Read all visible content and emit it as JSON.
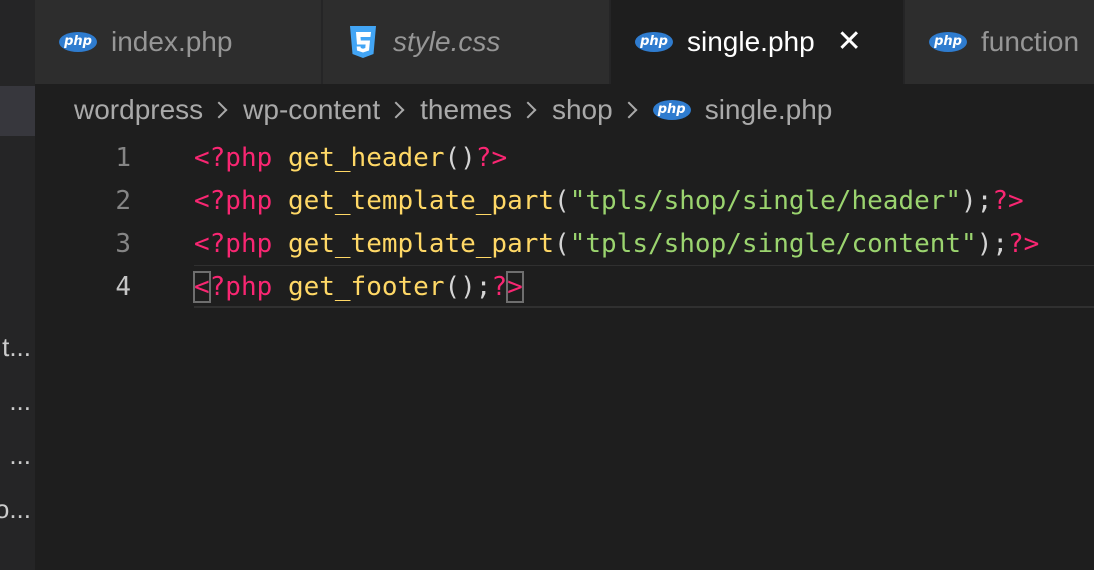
{
  "sidebar": {
    "truncated_items": [
      "t...",
      "...",
      "...",
      "o..."
    ]
  },
  "tabs": [
    {
      "label": "index.php",
      "icon": "php-icon",
      "icon_text": "php",
      "italic": false,
      "active": false
    },
    {
      "label": "style.css",
      "icon": "css3-icon",
      "italic": true,
      "active": false
    },
    {
      "label": "single.php",
      "icon": "php-icon",
      "icon_text": "php",
      "italic": false,
      "active": true,
      "close": "✕"
    },
    {
      "label": "function",
      "icon": "php-icon",
      "icon_text": "php",
      "italic": false,
      "active": false
    }
  ],
  "breadcrumb": {
    "items": [
      "wordpress",
      "wp-content",
      "themes",
      "shop"
    ],
    "file": "single.php",
    "file_icon_text": "php"
  },
  "editor": {
    "current_line": 4,
    "lines": [
      {
        "number": "1",
        "tokens": [
          {
            "t": "<?php",
            "k": "tag"
          },
          {
            "t": " ",
            "k": "pun"
          },
          {
            "t": "get_header",
            "k": "fn"
          },
          {
            "t": "()",
            "k": "pun"
          },
          {
            "t": "?>",
            "k": "tag"
          }
        ]
      },
      {
        "number": "2",
        "tokens": [
          {
            "t": "<?php",
            "k": "tag"
          },
          {
            "t": " ",
            "k": "pun"
          },
          {
            "t": "get_template_part",
            "k": "fn"
          },
          {
            "t": "(",
            "k": "pun"
          },
          {
            "t": "\"tpls/shop/single/header\"",
            "k": "str"
          },
          {
            "t": ");",
            "k": "pun"
          },
          {
            "t": "?>",
            "k": "tag"
          }
        ]
      },
      {
        "number": "3",
        "tokens": [
          {
            "t": "<?php",
            "k": "tag"
          },
          {
            "t": " ",
            "k": "pun"
          },
          {
            "t": "get_template_part",
            "k": "fn"
          },
          {
            "t": "(",
            "k": "pun"
          },
          {
            "t": "\"tpls/shop/single/content\"",
            "k": "str"
          },
          {
            "t": ");",
            "k": "pun"
          },
          {
            "t": "?>",
            "k": "tag"
          }
        ]
      },
      {
        "number": "4",
        "tokens": [
          {
            "t": "<",
            "k": "tag",
            "bracket": true
          },
          {
            "t": "?php",
            "k": "tag"
          },
          {
            "t": " ",
            "k": "pun"
          },
          {
            "t": "get_footer",
            "k": "fn"
          },
          {
            "t": "();",
            "k": "pun"
          },
          {
            "t": "?",
            "k": "tag"
          },
          {
            "t": ">",
            "k": "tag",
            "bracket": true
          }
        ]
      }
    ]
  },
  "colors": {
    "editor_bg": "#1e1e1e",
    "tab_inactive_bg": "#2d2d2d",
    "php_icon": "#2f7ccf",
    "css_icon": "#42a5f5",
    "keyword_tag": "#f92672",
    "function": "#ffd866",
    "string": "#9bd46f"
  }
}
